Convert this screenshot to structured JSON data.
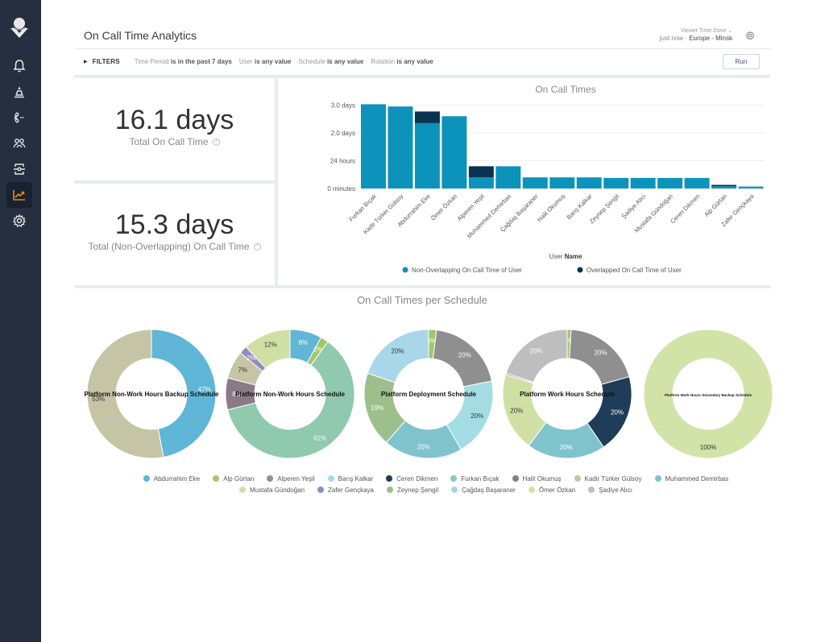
{
  "app": {
    "title": "On Call Time Analytics",
    "timestamp": "just now",
    "timezone_label": "Viewer Time Zone",
    "timezone_value": "Europe - Minsk",
    "run_label": "Run"
  },
  "sidebar": {
    "items": [
      {
        "name": "alerts",
        "icon": "bell-icon",
        "active": false
      },
      {
        "name": "incidents",
        "icon": "cone-icon",
        "active": false
      },
      {
        "name": "on-call",
        "icon": "phone-icon",
        "active": false
      },
      {
        "name": "teams",
        "icon": "users-icon",
        "active": false
      },
      {
        "name": "integrations",
        "icon": "integration-icon",
        "active": false
      },
      {
        "name": "analytics",
        "icon": "chart-icon",
        "active": true
      },
      {
        "name": "settings",
        "icon": "gear-icon",
        "active": false
      }
    ],
    "accent": "#e98a1e"
  },
  "filters": {
    "label": "FILTERS",
    "items": [
      {
        "field": "Time Period",
        "condition": "is in the past 7 days"
      },
      {
        "field": "User",
        "condition": "is any value"
      },
      {
        "field": "Schedule",
        "condition": "is any value"
      },
      {
        "field": "Rotation",
        "condition": "is any value"
      }
    ]
  },
  "kpis": [
    {
      "value": "16.1 days",
      "label": "Total On Call Time"
    },
    {
      "value": "15.3 days",
      "label": "Total (Non-Overlapping) On Call Time"
    }
  ],
  "colors": {
    "non_overlap": "#0c93bb",
    "overlap": "#0b3350"
  },
  "chart_data": [
    {
      "type": "bar",
      "stacked": true,
      "title": "On Call Times",
      "xlabel_prefix": "User",
      "xlabel_bold": "Name",
      "ylabel": "",
      "yticks": [
        {
          "value": 0,
          "label": "0 minutes"
        },
        {
          "value": 1,
          "label": "24 hours"
        },
        {
          "value": 2,
          "label": "2.0 days"
        },
        {
          "value": 3,
          "label": "3.0 days"
        }
      ],
      "ylim": [
        0,
        3.1
      ],
      "unit": "days",
      "grid": true,
      "legend_position": "bottom",
      "categories": [
        "Furkan Bıçak",
        "Kadir Türker Gülsoy",
        "Abdurrahim Eke",
        "Ömer Özkan",
        "Alperen Yeşil",
        "Muhammed Demirbas",
        "Çağdaş Başaraner",
        "Halit Okumuş",
        "Barış Kalkar",
        "Zeynep Şengil",
        "Şadiye Alıcı",
        "Mustafa Gündoğan",
        "Ceren Dikmen",
        "Alp Gürtan",
        "Zafer Gençkaya"
      ],
      "series": [
        {
          "name": "Non-Overlapping On Call Time of User",
          "values": [
            3.03,
            2.95,
            2.35,
            2.6,
            0.4,
            0.8,
            0.4,
            0.4,
            0.4,
            0.38,
            0.38,
            0.38,
            0.38,
            0.08,
            0.07
          ]
        },
        {
          "name": "Overlapped On Call Time of User",
          "values": [
            0,
            0,
            0.42,
            0,
            0.4,
            0,
            0,
            0,
            0,
            0,
            0,
            0,
            0,
            0.05,
            0
          ]
        }
      ]
    },
    {
      "type": "pie",
      "variant": "donut",
      "title": "On Call Times per Schedule",
      "legend_position": "bottom",
      "legend": [
        {
          "name": "Abdurrahim Eke",
          "color": "#5fb6d6"
        },
        {
          "name": "Alp Gürtan",
          "color": "#a3c56e"
        },
        {
          "name": "Alperen Yeşil",
          "color": "#8f8f8f"
        },
        {
          "name": "Barış Kalkar",
          "color": "#a3dde3"
        },
        {
          "name": "Ceren Dikmen",
          "color": "#1f3c5a"
        },
        {
          "name": "Furkan Bıçak",
          "color": "#8fc9ae"
        },
        {
          "name": "Halit Okumuş",
          "color": "#8a7a88"
        },
        {
          "name": "Kadir Türker Gülsoy",
          "color": "#c5c4a4"
        },
        {
          "name": "Muhammed Demirbas",
          "color": "#7fc3cd"
        },
        {
          "name": "Mustafa Gündoğan",
          "color": "#d0e0a4"
        },
        {
          "name": "Zafer Gençkaya",
          "color": "#938cc0"
        },
        {
          "name": "Zeynep Şengil",
          "color": "#9dbf8c"
        },
        {
          "name": "Çağdaş Başaraner",
          "color": "#a7d7e8"
        },
        {
          "name": "Ömer Özkan",
          "color": "#d2e3a8"
        },
        {
          "name": "Şadiye Alıcı",
          "color": "#bebebe"
        }
      ],
      "schedules": [
        {
          "name": "Platform Non-Work Hours Backup Schedule",
          "slices": [
            {
              "user": "Abdurrahim Eke",
              "value": 47,
              "label": "47%"
            },
            {
              "user": "Kadir Türker Gülsoy",
              "value": 53,
              "label": "53%"
            }
          ]
        },
        {
          "name": "Platform Non-Work Hours Schedule",
          "slices": [
            {
              "user": "Abdurrahim Eke",
              "value": 8,
              "label": "8%"
            },
            {
              "user": "Alp Gürtan",
              "value": 2,
              "label": "2%"
            },
            {
              "user": "Furkan Bıçak",
              "value": 61,
              "label": "61%"
            },
            {
              "user": "Halit Okumuş",
              "value": 8,
              "label": "8%"
            },
            {
              "user": "Kadir Türker Gülsoy",
              "value": 7,
              "label": "7%"
            },
            {
              "user": "Zafer Gençkaya",
              "value": 2,
              "label": "2%"
            },
            {
              "user": "Mustafa Gündoğan",
              "value": 12,
              "label": "12%"
            }
          ]
        },
        {
          "name": "Platform Deployment Schedule",
          "slices": [
            {
              "user": "Alp Gürtan",
              "value": 2,
              "label": "2%"
            },
            {
              "user": "Alperen Yeşil",
              "value": 20,
              "label": "20%"
            },
            {
              "user": "Barış Kalkar",
              "value": 20,
              "label": "20%"
            },
            {
              "user": "Muhammed Demirbas",
              "value": 20,
              "label": "20%"
            },
            {
              "user": "Zeynep Şengil",
              "value": 19,
              "label": "19%"
            },
            {
              "user": "Çağdaş Başaraner",
              "value": 20,
              "label": "20%"
            }
          ]
        },
        {
          "name": "Platform Work Hours Schedule",
          "slices": [
            {
              "user": "Alp Gürtan",
              "value": 1,
              "label": "1%"
            },
            {
              "user": "Alperen Yeşil",
              "value": 20,
              "label": "20%"
            },
            {
              "user": "Ceren Dikmen",
              "value": 20,
              "label": "20%"
            },
            {
              "user": "Muhammed Demirbas",
              "value": 20,
              "label": "20%"
            },
            {
              "user": "Mustafa Gündoğan",
              "value": 20,
              "label": "20%"
            },
            {
              "user": "Zafer Gençkaya",
              "value": 0.4,
              "label": ""
            },
            {
              "user": "Şadiye Alıcı",
              "value": 20,
              "label": "20%"
            }
          ]
        },
        {
          "name": "Platform Work Hours Secondary Backup Schedule",
          "slices": [
            {
              "user": "Ömer Özkan",
              "value": 100,
              "label": "100%"
            }
          ]
        }
      ]
    }
  ]
}
